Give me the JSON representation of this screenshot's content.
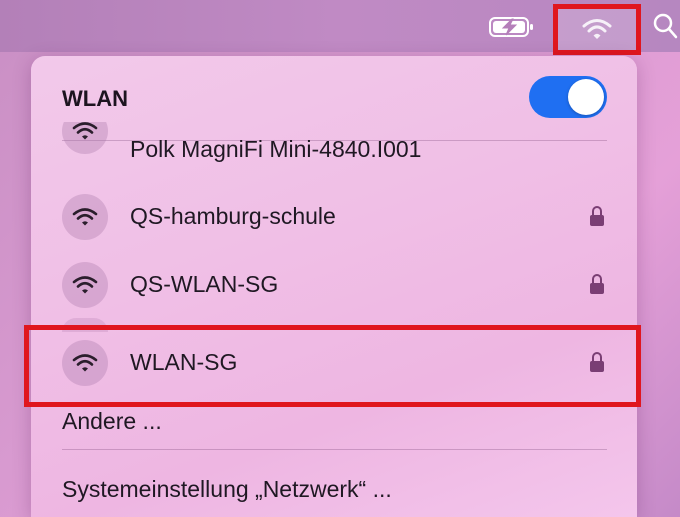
{
  "menubar": {
    "icons": [
      "battery-charging-icon",
      "wifi-icon",
      "search-icon"
    ]
  },
  "wlan_menu": {
    "title": "WLAN",
    "toggle_on": true,
    "networks": [
      {
        "name": "Polk MagniFi Mini-4840.I001",
        "locked": false
      },
      {
        "name": "QS-hamburg-schule",
        "locked": true
      },
      {
        "name": "QS-WLAN-SG",
        "locked": true
      },
      {
        "name": "WLAN-SG",
        "locked": true
      }
    ],
    "other_label": "Andere ...",
    "settings_label": "Systemeinstellung „Netzwerk“ ..."
  },
  "colors": {
    "toggle": "#1f6ff2",
    "highlight": "#e0161e",
    "lock": "#7a3e74"
  }
}
